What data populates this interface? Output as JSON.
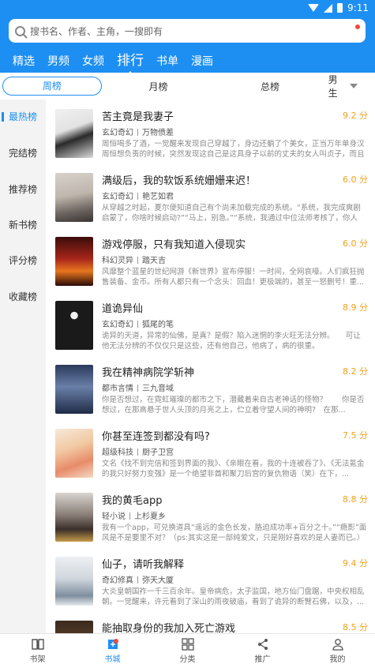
{
  "status_bar": {
    "time": "9:11"
  },
  "search": {
    "placeholder": "搜书名、作者、主角，一搜即有"
  },
  "top_tabs": [
    "精选",
    "男频",
    "女频",
    "排行",
    "书单",
    "漫画"
  ],
  "active_top_tab": "排行",
  "period_tabs": [
    "周榜",
    "月榜",
    "总榜"
  ],
  "active_period": "周榜",
  "gender_filter": "男生",
  "sidebar": [
    "最热榜",
    "完结榜",
    "推荐榜",
    "新书榜",
    "评分榜",
    "收藏榜"
  ],
  "active_sidebar": "最热榜",
  "books": [
    {
      "title": "苦主竟是我妻子",
      "score": "9.2 分",
      "category": "玄幻奇幻",
      "author": "万物偾差",
      "desc": "周恒喝多了酒，一觉醒来发现自己穿越了，身边还躺了个美女，正当万年单身汉周恒想负责的时候，突然发现这自己是这具身子以前的丈夫的女人叫贞子，而且就是罕见..."
    },
    {
      "title": "满级后，我的软饭系统姗姗来迟！",
      "score": "6.0 分",
      "category": "玄幻奇幻",
      "author": "艳艺如君",
      "desc": "从穿越之时起，夏尔便知道自己有个尚未加载完成的系统。“系统，我完成爽剧启蒙了，你啥时候启动?”“马上，别急。”“系统，我通过中位法师考核了，你人呢..."
    },
    {
      "title": "游戏停服，只有我知道入侵现实",
      "score": "6.0 分",
      "category": "科幻灵异",
      "author": "踏天吉",
      "desc": "风靡整个蓝星的世纪网游《新世界》宣布停服！一时间，全网哀嚎。人们疯狂抛售装备、金币。所有人都只有一个念头：回血！更极端的，甚至一怒删号！重..."
    },
    {
      "title": "道诡异仙",
      "score": "8.9 分",
      "category": "玄幻奇幻",
      "author": "狐尾的笔",
      "desc": "诡异的天道，异常的仙佛，是真？是假？陷入迷惘的李火旺无法分辨。　　可让他无法分辨的不仅仅只是这些，还有他自己，他病了，病的很重。"
    },
    {
      "title": "我在精神病院学斩神",
      "score": "8.2 分",
      "category": "都市言情",
      "author": "三九音域",
      "desc": "你是否想过，在霓虹璀璨的都市之下，潜藏着来自古老神话的怪物？　　你是否想过，在那高悬于世人头顶的月亮之上，伫立着守望人间的神明?　在那..."
    },
    {
      "title": "你甚至连签到都没有吗?",
      "score": "7.5 分",
      "category": "超级科技",
      "author": "厨子卫宫",
      "desc": "文名《找不到完信和签到界面的我》、《亲眼在看，我的十连被吞了》、《无法氪金的我只好努力变强》是一个绝望非酋和聚刀后宫的复仇物语（笑）在下，..."
    },
    {
      "title": "我的黄毛app",
      "score": "8.8 分",
      "category": "轻小说",
      "author": "上杉夏乡",
      "desc": "我有一个app，可兑换道具“遥远的金色长发，胳迫成功率+百分之十。”“瘾影”面风是不是要里不对？（ps:其实这是一部纯爱文，只是刚好喜欢的是人妻而已。）"
    },
    {
      "title": "仙子，请听我解释",
      "score": "9.4 分",
      "category": "奇幻修真",
      "author": "弥天大厦",
      "desc": "大炎皇朝国祚一千三百余年。皇帝病危，太子监国，地方仙门盘踞，中央权相乱朝。一觉醒来，许元看到了深山的雨夜破庙，看到了诡异的断臂石佛，以及，..."
    },
    {
      "title": "能抽取身份的我加入死亡游戏",
      "score": "8.5 分",
      "category": "",
      "author": "",
      "desc": ""
    }
  ],
  "bottom_nav": [
    "书架",
    "书城",
    "分类",
    "推广",
    "我的"
  ],
  "active_bottom_nav": "书城",
  "colors": {
    "brand": "#1e8ff2",
    "score": "#f1a21a",
    "badge": "#f04b3b"
  }
}
